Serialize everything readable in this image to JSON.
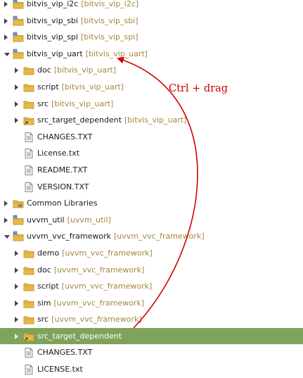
{
  "tree": [
    {
      "label": "bitvis_vip_i2c",
      "deco": "[bitvis_vip_i2c]",
      "depth": 0,
      "state": "collapsed",
      "icon": "project-folder-icon"
    },
    {
      "label": "bitvis_vip_sbi",
      "deco": "[bitvis_vip_sbi]",
      "depth": 0,
      "state": "collapsed",
      "icon": "project-folder-icon"
    },
    {
      "label": "bitvis_vip_spi",
      "deco": "[bitvis_vip_spi]",
      "depth": 0,
      "state": "collapsed",
      "icon": "project-folder-icon"
    },
    {
      "label": "bitvis_vip_uart",
      "deco": "[bitvis_vip_uart]",
      "depth": 0,
      "state": "expanded",
      "icon": "project-folder-icon"
    },
    {
      "label": "doc",
      "deco": "[bitvis_vip_uart]",
      "depth": 1,
      "state": "collapsed",
      "icon": "folder-icon"
    },
    {
      "label": "script",
      "deco": "[bitvis_vip_uart]",
      "depth": 1,
      "state": "collapsed",
      "icon": "folder-icon"
    },
    {
      "label": "src",
      "deco": "[bitvis_vip_uart]",
      "depth": 1,
      "state": "collapsed",
      "icon": "folder-icon"
    },
    {
      "label": "src_target_dependent",
      "deco": "[bitvis_vip_uart]",
      "depth": 1,
      "state": "collapsed",
      "icon": "linked-folder-icon"
    },
    {
      "label": "CHANGES.TXT",
      "deco": "",
      "depth": 1,
      "state": "leaf",
      "icon": "text-file-icon"
    },
    {
      "label": "License.txt",
      "deco": "",
      "depth": 1,
      "state": "leaf",
      "icon": "text-file-icon"
    },
    {
      "label": "README.TXT",
      "deco": "",
      "depth": 1,
      "state": "leaf",
      "icon": "text-file-icon"
    },
    {
      "label": "VERSION.TXT",
      "deco": "",
      "depth": 1,
      "state": "leaf",
      "icon": "text-file-icon"
    },
    {
      "label": "Common Libraries",
      "deco": "",
      "depth": 0,
      "state": "collapsed",
      "icon": "library-folder-icon"
    },
    {
      "label": "uvvm_util",
      "deco": "[uvvm_util]",
      "depth": 0,
      "state": "collapsed",
      "icon": "project-folder-icon"
    },
    {
      "label": "uvvm_vvc_framework",
      "deco": "[uvvm_vvc_framework]",
      "depth": 0,
      "state": "expanded",
      "icon": "project-folder-icon"
    },
    {
      "label": "demo",
      "deco": "[uvvm_vvc_framework]",
      "depth": 1,
      "state": "collapsed",
      "icon": "folder-icon"
    },
    {
      "label": "doc",
      "deco": "[uvvm_vvc_framework]",
      "depth": 1,
      "state": "collapsed",
      "icon": "folder-icon"
    },
    {
      "label": "script",
      "deco": "[uvvm_vvc_framework]",
      "depth": 1,
      "state": "collapsed",
      "icon": "folder-icon"
    },
    {
      "label": "sim",
      "deco": "[uvvm_vvc_framework]",
      "depth": 1,
      "state": "collapsed",
      "icon": "folder-icon"
    },
    {
      "label": "src",
      "deco": "[uvvm_vvc_framework]",
      "depth": 1,
      "state": "collapsed",
      "icon": "folder-icon"
    },
    {
      "label": "src_target_dependent",
      "deco": "",
      "depth": 1,
      "state": "collapsed",
      "icon": "linked-folder-icon",
      "selected": true
    },
    {
      "label": "CHANGES.TXT",
      "deco": "",
      "depth": 1,
      "state": "leaf",
      "icon": "text-file-icon"
    },
    {
      "label": "LICENSE.txt",
      "deco": "",
      "depth": 1,
      "state": "leaf",
      "icon": "text-file-icon"
    }
  ],
  "annotation": {
    "text": "Ctrl  +  drag",
    "color": "#d40000"
  },
  "colors": {
    "selection": "#7ea35a",
    "decoration": "#a08a3c",
    "folder": "#e7b84a"
  }
}
